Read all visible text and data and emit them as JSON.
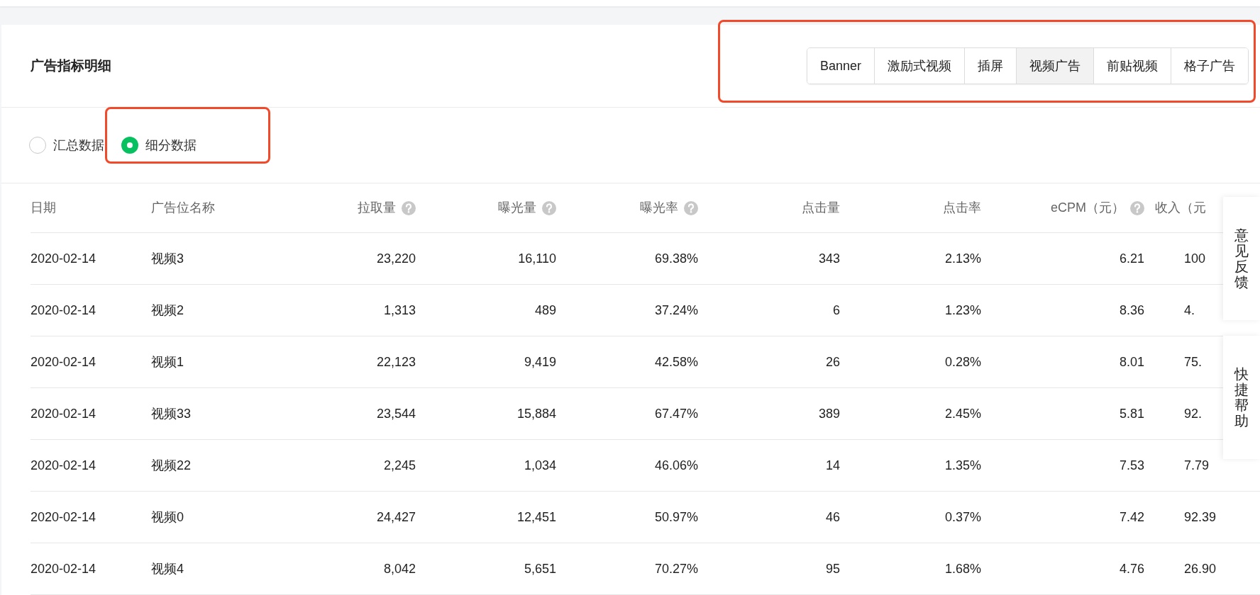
{
  "panel": {
    "title": "广告指标明细",
    "ad_types": [
      {
        "label": "Banner",
        "selected": false
      },
      {
        "label": "激励式视频",
        "selected": false
      },
      {
        "label": "插屏",
        "selected": false
      },
      {
        "label": "视频广告",
        "selected": true
      },
      {
        "label": "前贴视频",
        "selected": false
      },
      {
        "label": "格子广告",
        "selected": false
      }
    ],
    "data_modes": [
      {
        "label": "汇总数据",
        "selected": false
      },
      {
        "label": "细分数据",
        "selected": true
      }
    ],
    "table": {
      "columns": [
        {
          "label": "日期",
          "help": false
        },
        {
          "label": "广告位名称",
          "help": false
        },
        {
          "label": "拉取量",
          "help": true
        },
        {
          "label": "曝光量",
          "help": true
        },
        {
          "label": "曝光率",
          "help": true
        },
        {
          "label": "点击量",
          "help": false
        },
        {
          "label": "点击率",
          "help": false
        },
        {
          "label": "eCPM（元）",
          "help": true
        },
        {
          "label": "收入（元",
          "help": false
        }
      ],
      "rows": [
        [
          "2020-02-14",
          "视频3",
          "23,220",
          "16,110",
          "69.38%",
          "343",
          "2.13%",
          "6.21",
          "100"
        ],
        [
          "2020-02-14",
          "视频2",
          "1,313",
          "489",
          "37.24%",
          "6",
          "1.23%",
          "8.36",
          "4."
        ],
        [
          "2020-02-14",
          "视频1",
          "22,123",
          "9,419",
          "42.58%",
          "26",
          "0.28%",
          "8.01",
          "75."
        ],
        [
          "2020-02-14",
          "视频33",
          "23,544",
          "15,884",
          "67.47%",
          "389",
          "2.45%",
          "5.81",
          "92."
        ],
        [
          "2020-02-14",
          "视频22",
          "2,245",
          "1,034",
          "46.06%",
          "14",
          "1.35%",
          "7.53",
          "7.79"
        ],
        [
          "2020-02-14",
          "视频0",
          "24,427",
          "12,451",
          "50.97%",
          "46",
          "0.37%",
          "7.42",
          "92.39"
        ],
        [
          "2020-02-14",
          "视频4",
          "8,042",
          "5,651",
          "70.27%",
          "95",
          "1.68%",
          "4.76",
          "26.90"
        ]
      ]
    }
  },
  "float_buttons": [
    {
      "label": "意见反馈"
    },
    {
      "label": "快捷帮助"
    }
  ]
}
